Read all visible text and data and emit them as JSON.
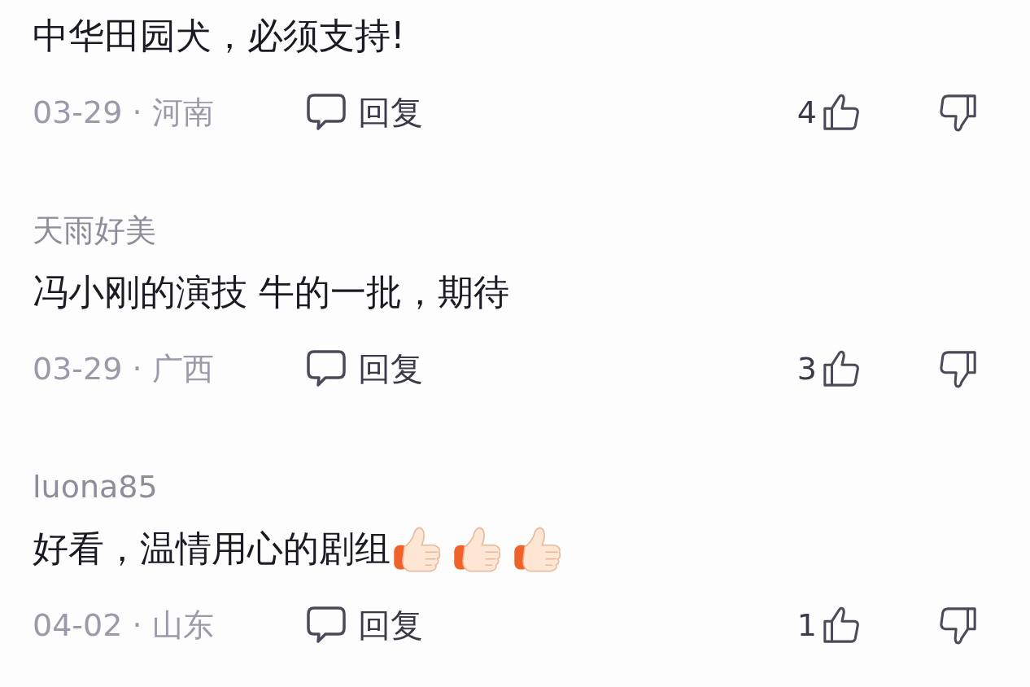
{
  "comments": [
    {
      "text": "中华田园犬，必须支持!",
      "meta": "03-29 · 河南",
      "reply": "回复",
      "likes": "4"
    },
    {
      "user": "天雨好美",
      "text": "冯小刚的演技 牛的一批，期待",
      "meta": "03-29 · 广西",
      "reply": "回复",
      "likes": "3"
    },
    {
      "user": "luona85",
      "text": "好看，温情用心的剧组",
      "emojis": [
        {
          "kind": "thumbs-up"
        },
        {
          "kind": "thumbs-up"
        },
        {
          "kind": "thumbs-up"
        }
      ],
      "meta": "04-02 · 山东",
      "reply": "回复",
      "likes": "1"
    }
  ]
}
